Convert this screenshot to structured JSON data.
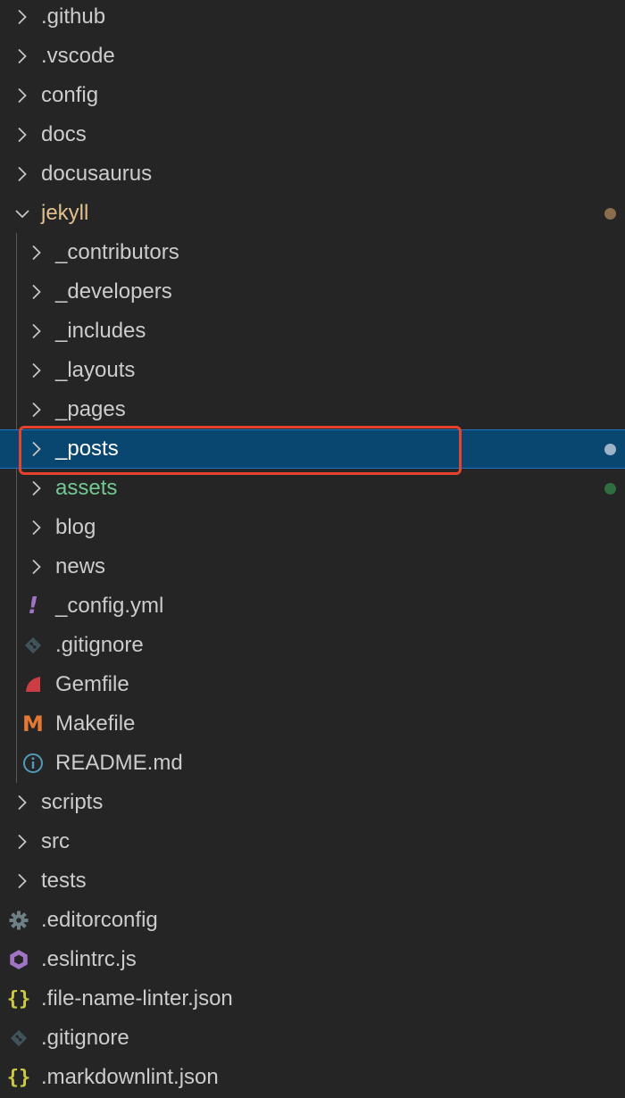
{
  "explorer": {
    "items": [
      {
        "label": ".github",
        "kind": "folder",
        "expanded": false,
        "depth": 0
      },
      {
        "label": ".vscode",
        "kind": "folder",
        "expanded": false,
        "depth": 0
      },
      {
        "label": "config",
        "kind": "folder",
        "expanded": false,
        "depth": 0
      },
      {
        "label": "docs",
        "kind": "folder",
        "expanded": false,
        "depth": 0
      },
      {
        "label": "docusaurus",
        "kind": "folder",
        "expanded": false,
        "depth": 0
      },
      {
        "label": "jekyll",
        "kind": "folder",
        "expanded": true,
        "depth": 0,
        "status": "modified"
      },
      {
        "label": "_contributors",
        "kind": "folder",
        "expanded": false,
        "depth": 1
      },
      {
        "label": "_developers",
        "kind": "folder",
        "expanded": false,
        "depth": 1
      },
      {
        "label": "_includes",
        "kind": "folder",
        "expanded": false,
        "depth": 1
      },
      {
        "label": "_layouts",
        "kind": "folder",
        "expanded": false,
        "depth": 1
      },
      {
        "label": "_pages",
        "kind": "folder",
        "expanded": false,
        "depth": 1
      },
      {
        "label": "_posts",
        "kind": "folder",
        "expanded": false,
        "depth": 1,
        "selected": true,
        "highlighted": true,
        "status": "selected-dot"
      },
      {
        "label": "assets",
        "kind": "folder",
        "expanded": false,
        "depth": 1,
        "status": "untracked"
      },
      {
        "label": "blog",
        "kind": "folder",
        "expanded": false,
        "depth": 1
      },
      {
        "label": "news",
        "kind": "folder",
        "expanded": false,
        "depth": 1
      },
      {
        "label": "_config.yml",
        "kind": "file",
        "icon": "yaml-exclamation-icon",
        "depth": 1
      },
      {
        "label": ".gitignore",
        "kind": "file",
        "icon": "git-icon",
        "depth": 1
      },
      {
        "label": "Gemfile",
        "kind": "file",
        "icon": "ruby-gem-icon",
        "depth": 1
      },
      {
        "label": "Makefile",
        "kind": "file",
        "icon": "makefile-m-icon",
        "depth": 1
      },
      {
        "label": "README.md",
        "kind": "file",
        "icon": "info-icon",
        "depth": 1
      },
      {
        "label": "scripts",
        "kind": "folder",
        "expanded": false,
        "depth": 0
      },
      {
        "label": "src",
        "kind": "folder",
        "expanded": false,
        "depth": 0
      },
      {
        "label": "tests",
        "kind": "folder",
        "expanded": false,
        "depth": 0
      },
      {
        "label": ".editorconfig",
        "kind": "file",
        "icon": "gear-icon",
        "depth": 0
      },
      {
        "label": ".eslintrc.js",
        "kind": "file",
        "icon": "eslint-icon",
        "depth": 0
      },
      {
        "label": ".file-name-linter.json",
        "kind": "file",
        "icon": "json-braces-icon",
        "depth": 0
      },
      {
        "label": ".gitignore",
        "kind": "file",
        "icon": "git-icon",
        "depth": 0
      },
      {
        "label": ".markdownlint.json",
        "kind": "file",
        "icon": "json-braces-icon",
        "depth": 0
      }
    ]
  },
  "colors": {
    "background": "#252526",
    "text": "#cccccc",
    "modified_label": "#e2c08d",
    "untracked_label": "#73c991",
    "selection": "#094771",
    "highlight_border": "#e5432e",
    "modified_dot": "#8a6e4b",
    "untracked_dot": "#2f6e3f",
    "selected_dot": "#9fb3c8"
  }
}
